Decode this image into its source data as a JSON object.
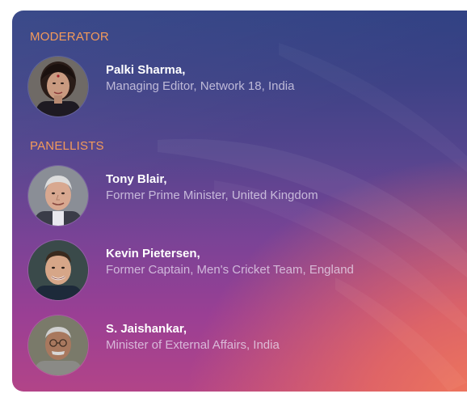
{
  "moderator_section": {
    "heading": "MODERATOR",
    "people": [
      {
        "name": "Palki Sharma,",
        "title": "Managing Editor, Network 18, India",
        "avatar_icon": "portrait-woman"
      }
    ]
  },
  "panellists_section": {
    "heading": "PANELLISTS",
    "people": [
      {
        "name": "Tony Blair,",
        "title": "Former Prime Minister, United Kingdom",
        "avatar_icon": "portrait-man-grey-hair"
      },
      {
        "name": "Kevin Pietersen,",
        "title": "Former Captain, Men's Cricket Team, England",
        "avatar_icon": "portrait-man-short-hair"
      },
      {
        "name": "S. Jaishankar,",
        "title": "Minister of External Affairs, India",
        "avatar_icon": "portrait-man-glasses"
      }
    ]
  },
  "colors": {
    "heading_accent": "#f39a5a",
    "name_text": "#ffffff",
    "title_text": "#ebe4f5"
  }
}
